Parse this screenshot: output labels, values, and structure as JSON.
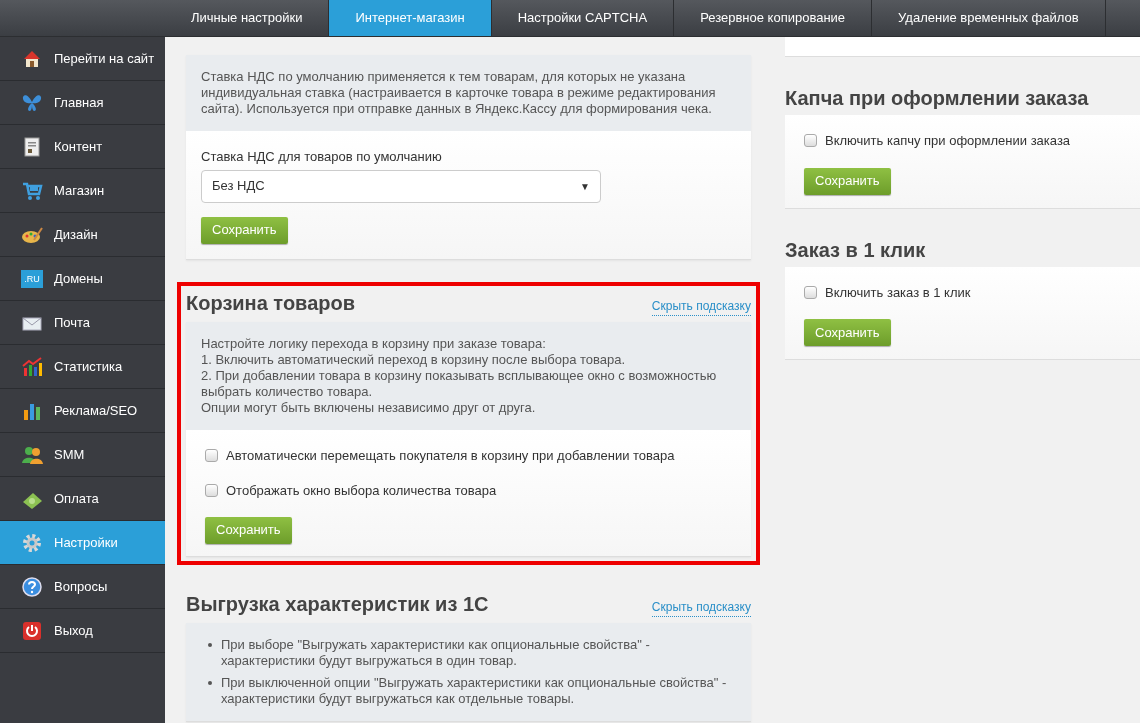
{
  "top_tabs": [
    {
      "label": "Личные настройки",
      "selected": false
    },
    {
      "label": "Интернет-магазин",
      "selected": true
    },
    {
      "label": "Настройки CAPTCHA",
      "selected": false
    },
    {
      "label": "Резервное копирование",
      "selected": false
    },
    {
      "label": "Удаление временных файлов",
      "selected": false
    }
  ],
  "sidebar": {
    "items": [
      {
        "label": "Перейти на сайт",
        "kind": "home",
        "selected": false
      },
      {
        "label": "Главная",
        "kind": "butterfly",
        "selected": false
      },
      {
        "label": "Контент",
        "kind": "document",
        "selected": false
      },
      {
        "label": "Магазин",
        "kind": "cart",
        "selected": false
      },
      {
        "label": "Дизайн",
        "kind": "palette",
        "selected": false
      },
      {
        "label": "Домены",
        "kind": "domain",
        "icon_text": ".RU",
        "selected": false
      },
      {
        "label": "Почта",
        "kind": "mail",
        "selected": false
      },
      {
        "label": "Статистика",
        "kind": "stats",
        "selected": false
      },
      {
        "label": "Реклама/SEO",
        "kind": "bars",
        "selected": false
      },
      {
        "label": "SMM",
        "kind": "people",
        "selected": false
      },
      {
        "label": "Оплата",
        "kind": "money",
        "selected": false
      },
      {
        "label": "Настройки",
        "kind": "gear",
        "selected": true
      },
      {
        "label": "Вопросы",
        "kind": "question",
        "selected": false
      },
      {
        "label": "Выход",
        "kind": "power",
        "selected": false
      }
    ]
  },
  "left_sections": [
    {
      "kind": "select_form",
      "highlighted": false,
      "hint_lines": [
        "Ставка НДС по умолчанию применяется к тем товарам, для которых не указана индивидуальная ставка (настраивается в карточке товара в режиме редактирования сайта). Используется при отправке данных в Яндекс.Кассу для формирования чека."
      ],
      "field_label": "Ставка НДС для товаров по умолчанию",
      "select_value": "Без НДС",
      "select_arrow": "▼",
      "save": "Сохранить"
    },
    {
      "kind": "checkbox_form",
      "highlighted": true,
      "title": "Корзина товаров",
      "hide_hint": "Скрыть подсказку",
      "hint_lines": [
        "Настройте логику перехода в корзину при заказе товара:",
        "1. Включить автоматический переход в корзину после выбора товара.",
        "2. При добавлении товара в корзину показывать всплывающее окно с возможностью выбрать количество товара.",
        "Опции могут быть включены независимо друг от друга."
      ],
      "checkboxes": [
        {
          "label": "Автоматически перемещать покупателя в корзину при добавлении товара",
          "checked": false
        },
        {
          "label": "Отображать окно выбора количества товара",
          "checked": false
        }
      ],
      "save": "Сохранить"
    },
    {
      "kind": "bullets",
      "highlighted": false,
      "title": "Выгрузка характеристик из 1С",
      "hide_hint": "Скрыть подсказку",
      "bullets": [
        "При выборе \"Выгружать характеристики как опциональные свойства\" - характеристики будут выгружаться в один товар.",
        "При выключенной опции \"Выгружать характеристики как опциональные свойства\" - характеристики будут выгружаться как отдельные товары."
      ]
    }
  ],
  "right_sections": [
    {
      "title": "Капча при оформлении заказа",
      "checkboxes": [
        {
          "label": "Включить капчу при оформлении заказа",
          "checked": false
        }
      ],
      "save": "Сохранить"
    },
    {
      "title": "Заказ в 1 клик",
      "checkboxes": [
        {
          "label": "Включить заказ в 1 клик",
          "checked": false
        }
      ],
      "save": "Сохранить"
    }
  ]
}
